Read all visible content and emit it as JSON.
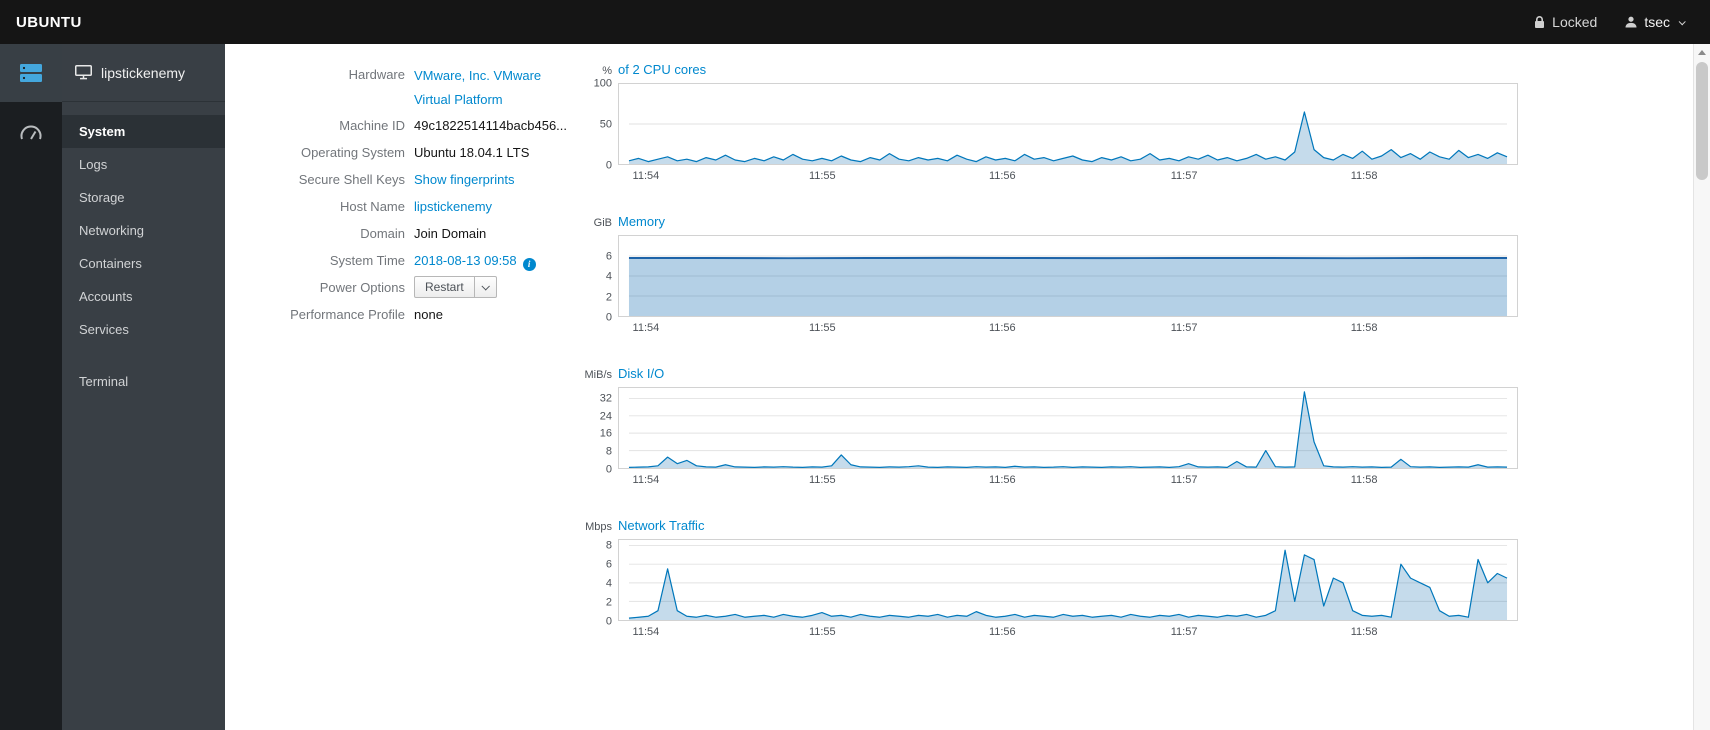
{
  "topbar": {
    "brand": "UBUNTU",
    "locked": "Locked",
    "user": "tsec"
  },
  "sidebar": {
    "host": "lipstickenemy",
    "items": [
      {
        "label": "System",
        "active": true
      },
      {
        "label": "Logs"
      },
      {
        "label": "Storage"
      },
      {
        "label": "Networking"
      },
      {
        "label": "Containers"
      },
      {
        "label": "Accounts"
      },
      {
        "label": "Services"
      },
      {
        "label": "Terminal"
      }
    ]
  },
  "system_info": {
    "hardware_label": "Hardware",
    "hardware_value": "VMware, Inc. VMware Virtual Platform",
    "machine_id_label": "Machine ID",
    "machine_id_value": "49c1822514114bacb456...",
    "os_label": "Operating System",
    "os_value": "Ubuntu 18.04.1 LTS",
    "ssh_label": "Secure Shell Keys",
    "ssh_value": "Show fingerprints",
    "hostname_label": "Host Name",
    "hostname_value": "lipstickenemy",
    "domain_label": "Domain",
    "domain_value": "Join Domain",
    "time_label": "System Time",
    "time_value": "2018-08-13 09:58",
    "power_label": "Power Options",
    "power_value": "Restart",
    "profile_label": "Performance Profile",
    "profile_value": "none"
  },
  "icons": {
    "info_glyph": "i"
  },
  "colors": {
    "accent": "#0088ce",
    "topbar_bg": "#151515",
    "sidebar_bg": "#393f45",
    "chart_line": "#0077bb",
    "chart_fill": "rgba(40,121,182,0.27)"
  },
  "charts": [
    {
      "type": "area",
      "unit": "%",
      "title": "of 2 CPU cores",
      "ymax": 100,
      "y_ticks": [
        0,
        50,
        100
      ],
      "x_labels": [
        "11:54",
        "11:55",
        "11:56",
        "11:57",
        "11:58"
      ],
      "x_pos": [
        0.031,
        0.227,
        0.427,
        0.629,
        0.829
      ],
      "stroke": "#0077bb",
      "stroke_width": 1.25,
      "fill": "rgba(40,121,182,0.27)",
      "values": [
        4,
        7,
        3,
        6,
        9,
        4,
        6,
        3,
        8,
        5,
        11,
        5,
        3,
        7,
        4,
        9,
        5,
        12,
        6,
        4,
        7,
        4,
        10,
        5,
        3,
        8,
        5,
        13,
        6,
        4,
        8,
        5,
        7,
        4,
        11,
        6,
        3,
        9,
        5,
        7,
        4,
        12,
        6,
        8,
        4,
        7,
        10,
        5,
        3,
        8,
        5,
        9,
        4,
        6,
        13,
        5,
        7,
        4,
        9,
        6,
        11,
        5,
        8,
        4,
        7,
        12,
        6,
        9,
        5,
        15,
        65,
        18,
        8,
        5,
        12,
        7,
        16,
        6,
        10,
        18,
        8,
        13,
        6,
        15,
        9,
        6,
        17,
        8,
        12,
        7,
        14,
        9
      ]
    },
    {
      "type": "area",
      "unit": "GiB",
      "title": "Memory",
      "ymax": 8,
      "y_ticks": [
        0,
        2,
        4,
        6
      ],
      "x_labels": [
        "11:54",
        "11:55",
        "11:56",
        "11:57",
        "11:58"
      ],
      "x_pos": [
        0.031,
        0.227,
        0.427,
        0.629,
        0.829
      ],
      "stroke": "#1d63a8",
      "stroke_width": 2,
      "fill": "rgba(40,121,182,0.35)",
      "values": [
        5.8,
        5.8,
        5.78,
        5.8,
        5.81,
        5.8,
        5.79,
        5.8,
        5.8,
        5.78,
        5.8,
        5.8
      ]
    },
    {
      "type": "area",
      "unit": "MiB/s",
      "title": "Disk I/O",
      "ymax": 36.8,
      "y_ticks": [
        0,
        8,
        16,
        24,
        32
      ],
      "x_labels": [
        "11:54",
        "11:55",
        "11:56",
        "11:57",
        "11:58"
      ],
      "x_pos": [
        0.031,
        0.227,
        0.427,
        0.629,
        0.829
      ],
      "stroke": "#0077bb",
      "stroke_width": 1.25,
      "fill": "rgba(40,121,182,0.27)",
      "values": [
        0.3,
        0.4,
        0.5,
        1,
        5,
        2,
        3.5,
        1,
        0.5,
        0.4,
        1.5,
        0.5,
        0.4,
        0.3,
        0.5,
        0.4,
        0.6,
        0.4,
        0.3,
        0.5,
        0.4,
        1,
        6,
        1.5,
        0.5,
        0.4,
        0.3,
        0.5,
        0.4,
        0.6,
        1,
        0.4,
        0.3,
        0.5,
        0.4,
        0.3,
        0.6,
        0.4,
        0.5,
        0.3,
        0.8,
        0.4,
        0.5,
        0.3,
        0.4,
        0.6,
        0.3,
        0.5,
        0.4,
        0.3,
        0.5,
        0.4,
        0.6,
        0.3,
        0.4,
        0.5,
        0.3,
        0.6,
        2,
        0.5,
        0.4,
        0.5,
        0.3,
        3,
        0.5,
        0.4,
        8,
        0.6,
        0.4,
        0.5,
        35,
        12,
        1,
        0.5,
        0.4,
        0.6,
        0.4,
        0.5,
        0.3,
        0.4,
        4,
        0.6,
        0.4,
        0.5,
        0.3,
        0.4,
        0.5,
        0.4,
        1.5,
        0.4,
        0.5,
        0.4
      ]
    },
    {
      "type": "area",
      "unit": "Mbps",
      "title": "Network Traffic",
      "ymax": 8.6,
      "y_ticks": [
        0,
        2,
        4,
        6,
        8
      ],
      "x_labels": [
        "11:54",
        "11:55",
        "11:56",
        "11:57",
        "11:58"
      ],
      "x_pos": [
        0.031,
        0.227,
        0.427,
        0.629,
        0.829
      ],
      "stroke": "#0077bb",
      "stroke_width": 1.25,
      "fill": "rgba(40,121,182,0.27)",
      "values": [
        0.2,
        0.3,
        0.4,
        1,
        5.5,
        1,
        0.4,
        0.3,
        0.5,
        0.3,
        0.4,
        0.6,
        0.3,
        0.4,
        0.5,
        0.3,
        0.6,
        0.4,
        0.3,
        0.5,
        0.8,
        0.4,
        0.5,
        0.3,
        0.6,
        0.4,
        0.3,
        0.5,
        0.4,
        0.3,
        0.5,
        0.4,
        0.6,
        0.3,
        0.5,
        0.4,
        0.9,
        0.5,
        0.3,
        0.4,
        0.6,
        0.3,
        0.5,
        0.4,
        0.3,
        0.6,
        0.4,
        0.5,
        0.3,
        0.4,
        0.5,
        0.3,
        0.6,
        0.4,
        0.3,
        0.5,
        0.4,
        0.6,
        0.3,
        0.5,
        0.4,
        0.3,
        0.5,
        0.4,
        0.6,
        0.3,
        0.5,
        1,
        7.5,
        2,
        7,
        6.5,
        1.5,
        4.5,
        4,
        1,
        0.5,
        0.4,
        0.5,
        0.3,
        6,
        4.5,
        4,
        3.5,
        1,
        0.4,
        0.5,
        0.3,
        6.5,
        4,
        5,
        4.5
      ]
    }
  ]
}
